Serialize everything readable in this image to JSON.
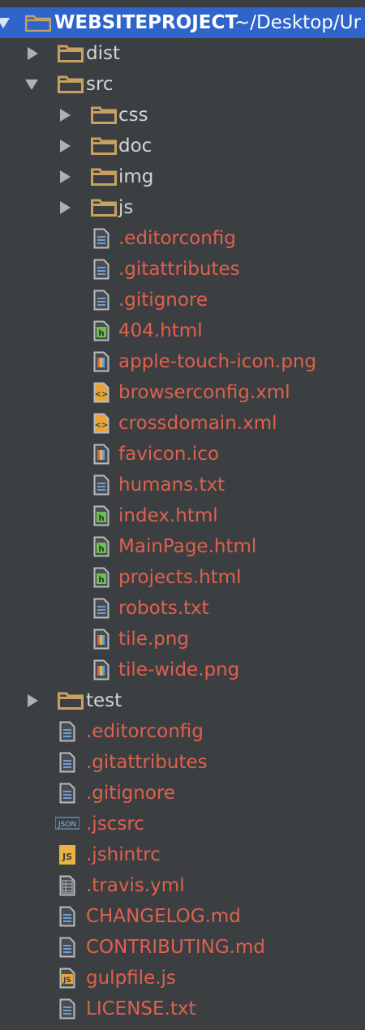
{
  "root": {
    "name": "WEBSITEPROJECT",
    "path": "~/Desktop/Ur"
  },
  "rows": [
    {
      "label": "dist",
      "type": "folder",
      "state": "collapsed",
      "depth": 1
    },
    {
      "label": "src",
      "type": "folder",
      "state": "expanded",
      "depth": 1
    },
    {
      "label": "css",
      "type": "folder",
      "state": "collapsed",
      "depth": 2
    },
    {
      "label": "doc",
      "type": "folder",
      "state": "collapsed",
      "depth": 2
    },
    {
      "label": "img",
      "type": "folder",
      "state": "collapsed",
      "depth": 2
    },
    {
      "label": "js",
      "type": "folder",
      "state": "collapsed",
      "depth": 2
    },
    {
      "label": ".editorconfig",
      "type": "text",
      "depth": 2
    },
    {
      "label": ".gitattributes",
      "type": "text",
      "depth": 2
    },
    {
      "label": ".gitignore",
      "type": "text",
      "depth": 2
    },
    {
      "label": "404.html",
      "type": "html",
      "depth": 2
    },
    {
      "label": "apple-touch-icon.png",
      "type": "image",
      "depth": 2
    },
    {
      "label": "browserconfig.xml",
      "type": "xml",
      "depth": 2
    },
    {
      "label": "crossdomain.xml",
      "type": "xml",
      "depth": 2
    },
    {
      "label": "favicon.ico",
      "type": "image",
      "depth": 2
    },
    {
      "label": "humans.txt",
      "type": "text",
      "depth": 2
    },
    {
      "label": "index.html",
      "type": "html",
      "depth": 2
    },
    {
      "label": "MainPage.html",
      "type": "html",
      "depth": 2
    },
    {
      "label": "projects.html",
      "type": "html",
      "depth": 2
    },
    {
      "label": "robots.txt",
      "type": "text",
      "depth": 2
    },
    {
      "label": "tile.png",
      "type": "image",
      "depth": 2
    },
    {
      "label": "tile-wide.png",
      "type": "image",
      "depth": 2
    },
    {
      "label": "test",
      "type": "folder",
      "state": "collapsed",
      "depth": 1
    },
    {
      "label": ".editorconfig",
      "type": "text",
      "depth": 1
    },
    {
      "label": ".gitattributes",
      "type": "text",
      "depth": 1
    },
    {
      "label": ".gitignore",
      "type": "text",
      "depth": 1
    },
    {
      "label": ".jscsrc",
      "type": "json",
      "depth": 1
    },
    {
      "label": ".jshintrc",
      "type": "js",
      "depth": 1
    },
    {
      "label": ".travis.yml",
      "type": "table",
      "depth": 1
    },
    {
      "label": "CHANGELOG.md",
      "type": "text",
      "depth": 1
    },
    {
      "label": "CONTRIBUTING.md",
      "type": "text",
      "depth": 1
    },
    {
      "label": "gulpfile.js",
      "type": "jsfile",
      "depth": 1
    },
    {
      "label": "LICENSE.txt",
      "type": "text",
      "depth": 1
    }
  ],
  "colors": {
    "background": "#3c3f41",
    "header": "#2f65ca",
    "folder": "#c8a060",
    "file_text": "#e0604e",
    "dir_text": "#d4d4d4"
  }
}
